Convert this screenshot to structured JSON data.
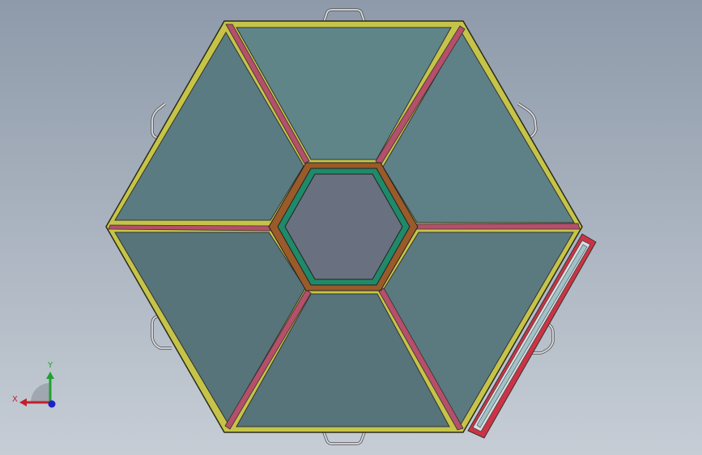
{
  "viewport": {
    "background_top": "#8e9aaa",
    "background_bottom": "#c6cdd5"
  },
  "model": {
    "panel_colors": {
      "top": "#5f8589",
      "upper_right": "#5e8187",
      "upper_left": "#5a7b81",
      "lower_left": "#567479",
      "lower_right": "#5a7a80",
      "bottom": "#567479",
      "center": "#69707f"
    },
    "frame_yellow": "#c6c448",
    "frame_red": "#b54f6a",
    "frame_orange": "#9a5a2a",
    "frame_green": "#1f8a6a",
    "drawer_glass": "#9fc3c8",
    "drawer_red": "#cc3344",
    "handle_color": "#dadde2"
  },
  "triad": {
    "x_label": "X",
    "y_label": "Y",
    "x_color": "#c0202a",
    "y_color": "#20a030",
    "z_color": "#1a22c8"
  }
}
